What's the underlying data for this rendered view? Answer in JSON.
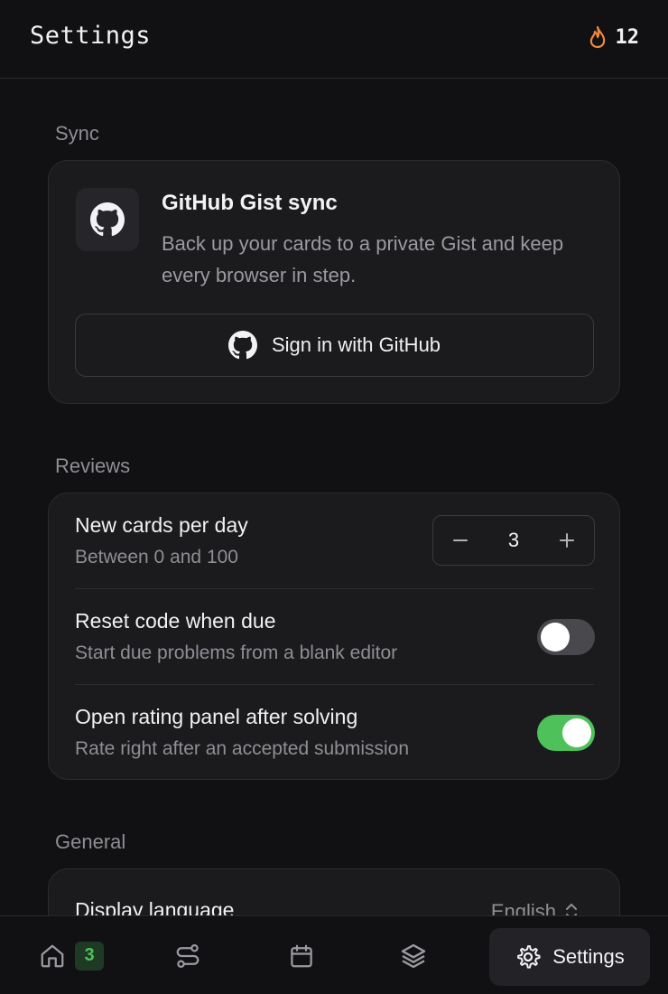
{
  "header": {
    "title": "Settings",
    "streak_icon": "flame-icon",
    "streak_count": "12",
    "streak_color": "#f0883e"
  },
  "sync": {
    "section_label": "Sync",
    "title": "GitHub Gist sync",
    "description": "Back up your cards to a private Gist and keep every browser in step.",
    "signin_label": "Sign in with GitHub"
  },
  "reviews": {
    "section_label": "Reviews",
    "new_cards": {
      "title": "New cards per day",
      "subtitle": "Between 0 and 100",
      "value": "3"
    },
    "reset_code": {
      "title": "Reset code when due",
      "subtitle": "Start due problems from a blank editor",
      "enabled": false
    },
    "rating_panel": {
      "title": "Open rating panel after solving",
      "subtitle": "Rate right after an accepted submission",
      "enabled": true
    }
  },
  "general": {
    "section_label": "General",
    "display_language": {
      "title": "Display language",
      "value": "English"
    }
  },
  "nav": {
    "home_badge": "3",
    "active_label": "Settings",
    "icons": [
      "home-icon",
      "route-icon",
      "calendar-icon",
      "layers-icon",
      "gear-icon"
    ]
  },
  "colors": {
    "accent_green": "#4ec15a",
    "flame": "#f0883e",
    "background": "#111113",
    "card": "#1b1b1e"
  }
}
